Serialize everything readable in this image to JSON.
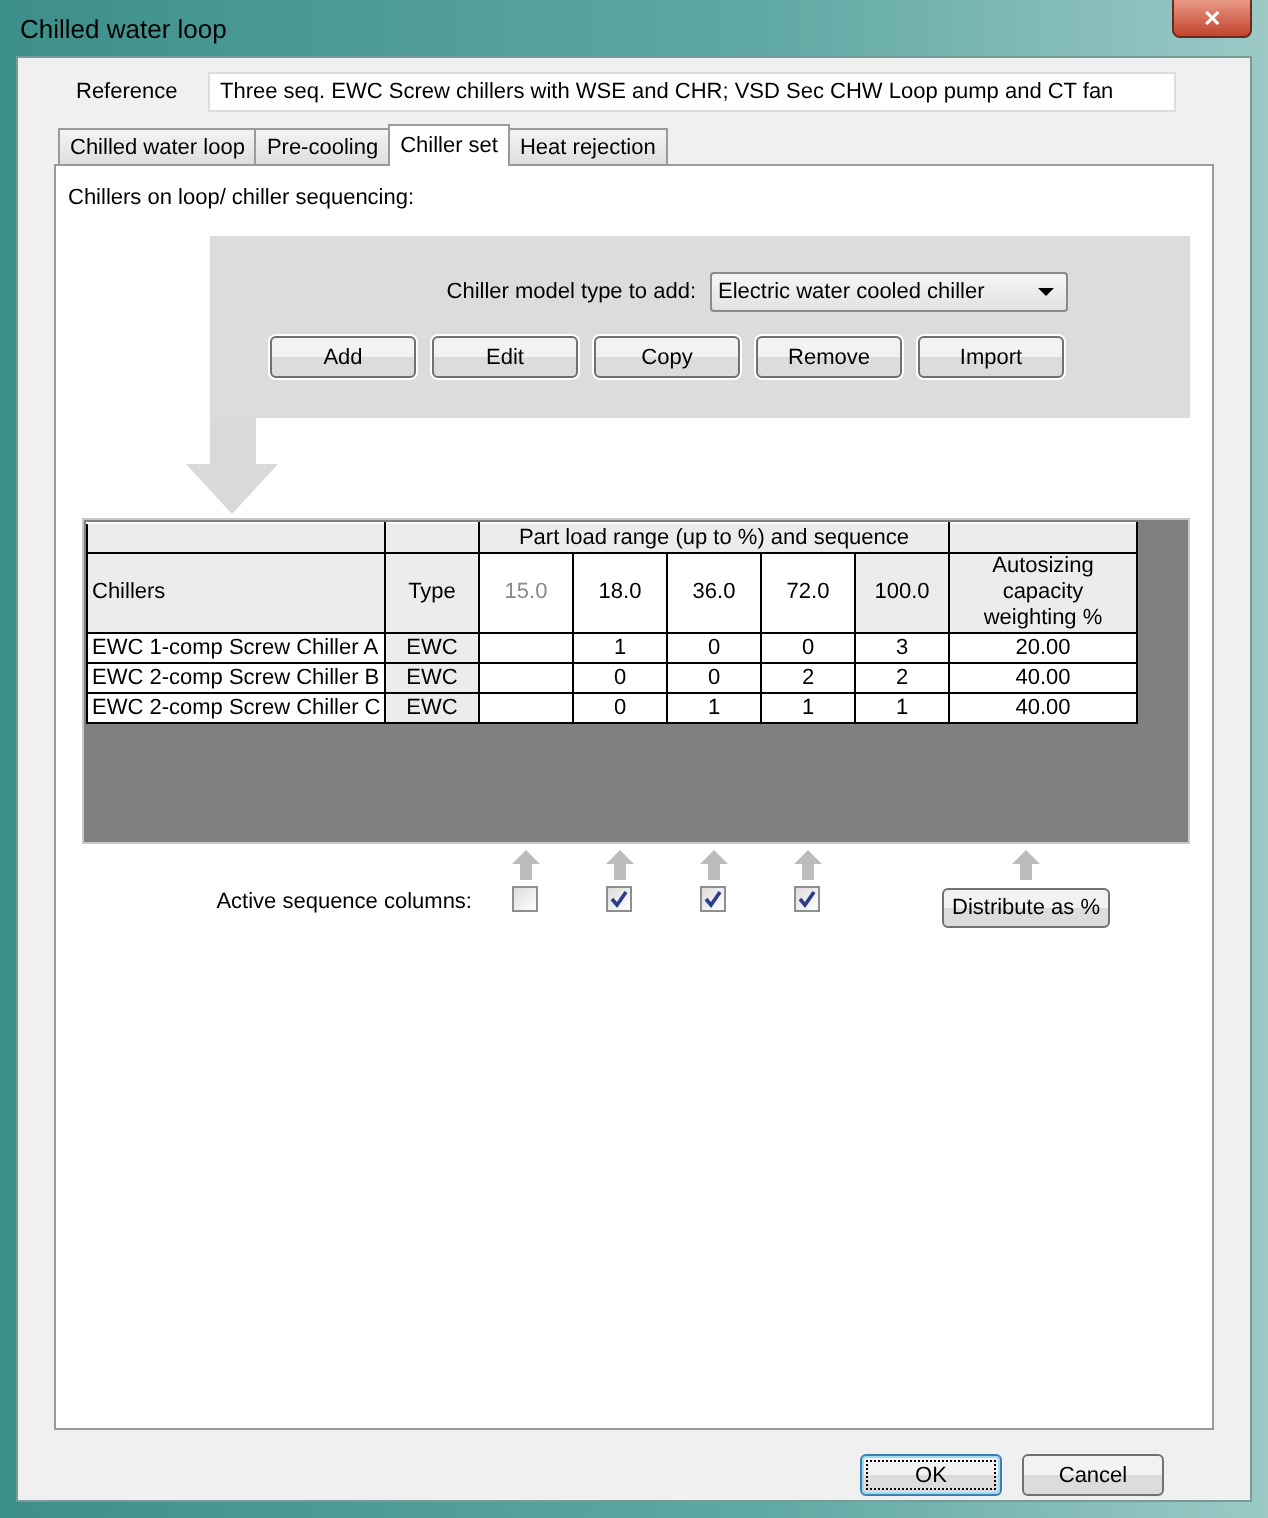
{
  "window": {
    "title": "Chilled water loop",
    "close": "✕"
  },
  "reference": {
    "label": "Reference",
    "value": "Three seq. EWC Screw chillers with WSE and CHR; VSD Sec CHW Loop pump and CT fan"
  },
  "tabs": [
    {
      "label": "Chilled water loop",
      "selected": false
    },
    {
      "label": "Pre-cooling",
      "selected": false
    },
    {
      "label": "Chiller set",
      "selected": true
    },
    {
      "label": "Heat rejection",
      "selected": false
    }
  ],
  "section_label": "Chillers on loop/ chiller sequencing:",
  "model_type": {
    "label": "Chiller model type to add:",
    "value": "Electric water cooled chiller"
  },
  "actions": [
    "Add",
    "Edit",
    "Copy",
    "Remove",
    "Import"
  ],
  "table": {
    "group_header": "Part load range (up to %) and sequence",
    "columns": {
      "name": "Chillers",
      "type": "Type",
      "weight": "Autosizing capacity weighting %"
    },
    "load_columns": [
      {
        "label": "15.0",
        "kind": "toggle",
        "checked": false
      },
      {
        "label": "18.0",
        "kind": "toggle",
        "checked": true
      },
      {
        "label": "36.0",
        "kind": "toggle",
        "checked": true
      },
      {
        "label": "72.0",
        "kind": "toggle",
        "checked": true
      },
      {
        "label": "100.0",
        "kind": "fixed"
      }
    ],
    "rows": [
      {
        "name": "EWC 1-comp Screw Chiller A",
        "type": "EWC",
        "sequence": [
          "1",
          "0",
          "0",
          "3"
        ],
        "weight": "20.00"
      },
      {
        "name": "EWC 2-comp Screw Chiller B",
        "type": "EWC",
        "sequence": [
          "0",
          "0",
          "2",
          "2"
        ],
        "weight": "40.00"
      },
      {
        "name": "EWC 2-comp Screw Chiller C",
        "type": "EWC",
        "sequence": [
          "0",
          "1",
          "1",
          "1"
        ],
        "weight": "40.00"
      }
    ]
  },
  "active_label": "Active sequence columns:",
  "distribute": "Distribute as %",
  "buttons": [
    {
      "label": "OK",
      "default": true
    },
    {
      "label": "Cancel",
      "default": false
    }
  ]
}
